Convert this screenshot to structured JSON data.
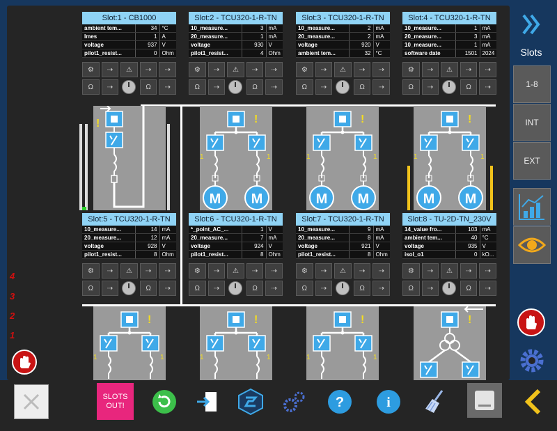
{
  "sidebar": {
    "slots_label": "Slots",
    "btn_1_8": "1-8",
    "btn_int": "INT",
    "btn_ext": "EXT"
  },
  "bottom": {
    "slots_out_line1": "SLOTS",
    "slots_out_line2": "OUT!"
  },
  "levels": [
    "4",
    "3",
    "2",
    "1"
  ],
  "slots": [
    {
      "title": "Slot:1 - CB1000",
      "rows": [
        [
          "ambient tem...",
          "34",
          "°C"
        ],
        [
          "Imes",
          "1",
          "A"
        ],
        [
          "voltage",
          "937",
          "V"
        ],
        [
          "pilot1_resist...",
          "0",
          "Ohm"
        ]
      ]
    },
    {
      "title": "Slot:2 - TCU320-1-R-TN",
      "rows": [
        [
          "10_measure...",
          "3",
          "mA"
        ],
        [
          "20_measure...",
          "1",
          "mA"
        ],
        [
          "voltage",
          "930",
          "V"
        ],
        [
          "pilot1_resist...",
          "4",
          "Ohm"
        ]
      ]
    },
    {
      "title": "Slot:3 - TCU320-1-R-TN",
      "rows": [
        [
          "10_measure...",
          "2",
          "mA"
        ],
        [
          "20_measure...",
          "2",
          "mA"
        ],
        [
          "voltage",
          "920",
          "V"
        ],
        [
          "ambient tem...",
          "32",
          "°C"
        ]
      ]
    },
    {
      "title": "Slot:4 - TCU320-1-R-TN",
      "rows": [
        [
          "10_measure...",
          "1",
          "mA"
        ],
        [
          "20_measure...",
          "3",
          "mA"
        ],
        [
          "10_measure...",
          "1",
          "mA"
        ],
        [
          "software date",
          "1501",
          "2024"
        ]
      ]
    },
    {
      "title": "Slot:5 - TCU320-1-R-TN",
      "rows": [
        [
          "10_measure...",
          "14",
          "mA"
        ],
        [
          "20_measure...",
          "12",
          "mA"
        ],
        [
          "voltage",
          "928",
          "V"
        ],
        [
          "pilot1_resist...",
          "8",
          "Ohm"
        ]
      ]
    },
    {
      "title": "Slot:6 - TCU320-1-R-TN",
      "rows": [
        [
          "*_point_AC_...",
          "1",
          "V"
        ],
        [
          "20_measure...",
          "7",
          "mA"
        ],
        [
          "voltage",
          "924",
          "V"
        ],
        [
          "pilot1_resist...",
          "8",
          "Ohm"
        ]
      ]
    },
    {
      "title": "Slot:7 - TCU320-1-R-TN",
      "rows": [
        [
          "10_measure...",
          "9",
          "mA"
        ],
        [
          "20_measure...",
          "8",
          "mA"
        ],
        [
          "voltage",
          "921",
          "V"
        ],
        [
          "pilot1_resist...",
          "8",
          "Ohm"
        ]
      ]
    },
    {
      "title": "Slot:8 - TU-2D-TN_230V",
      "rows": [
        [
          "14_value fro...",
          "103",
          "mA"
        ],
        [
          "ambient tem...",
          "40",
          "°C"
        ],
        [
          "voltage",
          "935",
          "V"
        ],
        [
          "isol_o1",
          "0",
          "kO..."
        ]
      ]
    }
  ],
  "diagram": {
    "branch_label": "1",
    "warning_glyph": "!",
    "motor_label": "M"
  },
  "colors": {
    "title_bg": "#8fd3f5",
    "accent_blue": "#3fa9e8",
    "warn_yellow": "#f5dd20",
    "level_yellow": "#f1c21b",
    "slots_out_pink": "#e8267d"
  }
}
